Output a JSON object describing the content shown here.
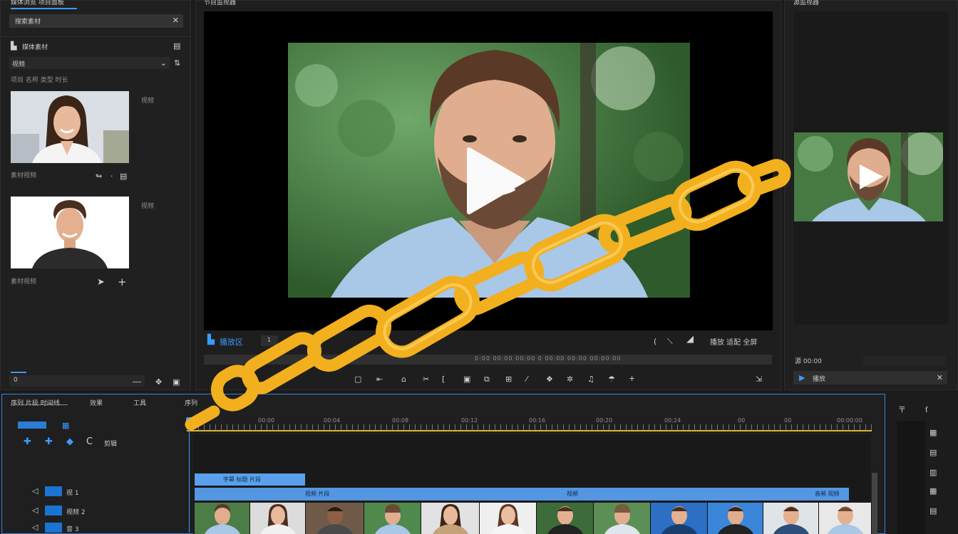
{
  "app": {
    "left_panel_tab": "媒体浏览 项目面板",
    "program_title": "节目监视器",
    "right_title": "源监视器"
  },
  "search": {
    "value": "搜索素材"
  },
  "media": {
    "section_label": "媒体素材",
    "filter_value": "视频",
    "subheader": "项目 名称 类型 时长",
    "items": [
      {
        "label_right": "视频",
        "label_bottom": "素材视频",
        "icon_a": "➤",
        "icon_b": "+"
      },
      {
        "label_right": "视频",
        "label_bottom": "素材视频",
        "icon_a": "➤",
        "icon_b": "+"
      }
    ],
    "bottom_field": "0"
  },
  "viewer": {
    "left_label": "播放区",
    "left_code": "1",
    "right_label": "播放 适配 全屏",
    "scrub_text": "0:00 00:00 00:00 0 00:00 00:00 00:00:00"
  },
  "right_panel": {
    "dropdown_label": "源 00:00",
    "play_label": "播放"
  },
  "timeline": {
    "header": [
      "序列 片段 时间线",
      "效果",
      "工具",
      "序列"
    ],
    "ruler_labels": [
      "00:00",
      "00:04",
      "00:08",
      "00:12",
      "00:16",
      "00:20",
      "00:24",
      "00",
      "00",
      "00:00",
      "00:00:00"
    ],
    "track_top_label": "字幕 标题 片段",
    "track_mid_label": "视频 片段",
    "track_mid_center": "视频",
    "track_mid_right": "音频 视频",
    "tracks": [
      {
        "label": "视 1"
      },
      {
        "label": "视频 2"
      },
      {
        "label": "音 3"
      }
    ],
    "tool_label": "剪辑"
  },
  "colors": {
    "accent": "#3a9bff",
    "chain": "#f2b01e",
    "clip_blue": "#4f8fd9"
  }
}
